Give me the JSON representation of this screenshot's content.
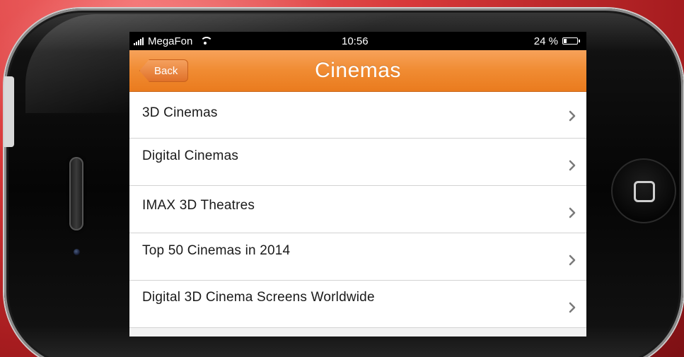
{
  "status_bar": {
    "carrier": "MegaFon",
    "time": "10:56",
    "battery": "24 %",
    "battery_level": 0.24
  },
  "nav": {
    "title": "Cinemas",
    "back_label": "Back"
  },
  "list": {
    "items": [
      {
        "label": "3D Cinemas"
      },
      {
        "label": "Digital Cinemas"
      },
      {
        "label": "IMAX 3D Theatres"
      },
      {
        "label": "Top 50 Cinemas in 2014"
      },
      {
        "label": "Digital 3D Cinema Screens Worldwide"
      }
    ]
  },
  "colors": {
    "nav_orange": "#f08b32",
    "background_red": "#d8393a"
  },
  "icons": {
    "signal": "signal-bars-icon",
    "wifi": "wifi-icon",
    "battery": "battery-icon",
    "chevron": "chevron-right-icon",
    "home": "home-button-icon"
  }
}
